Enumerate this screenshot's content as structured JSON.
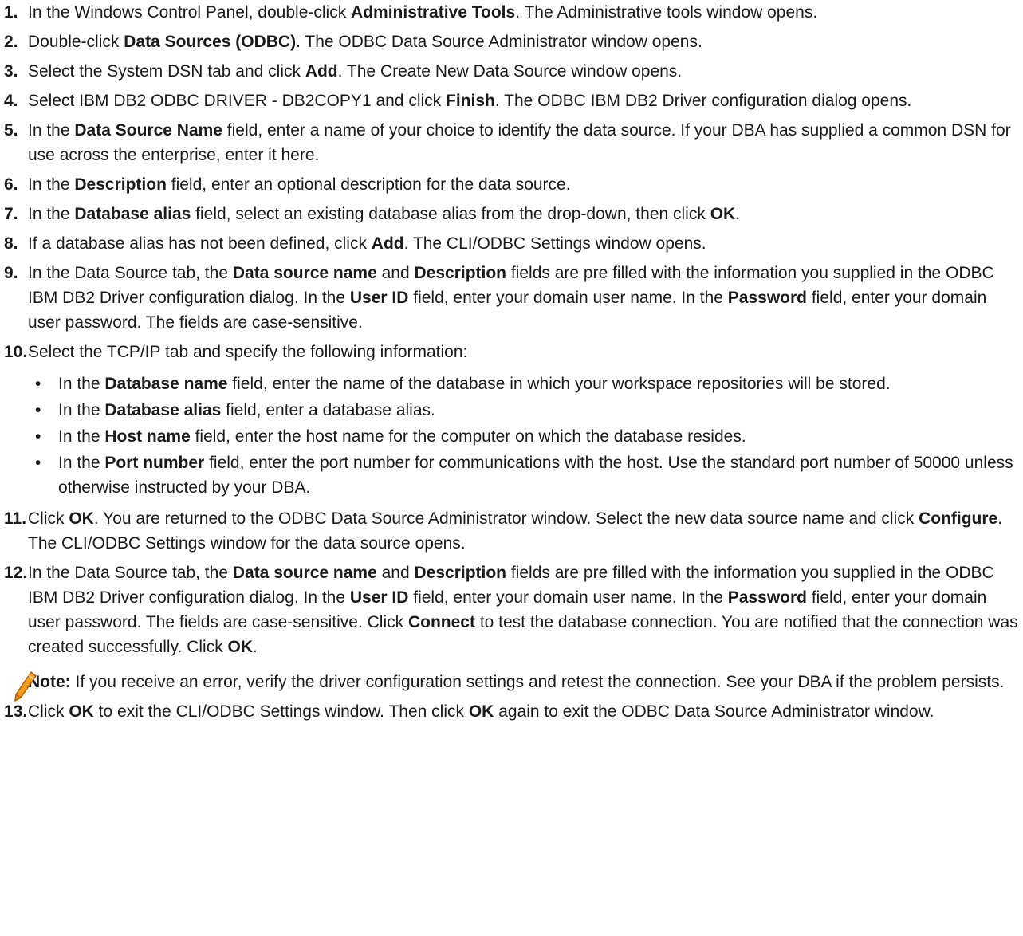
{
  "steps": [
    {
      "n": "1.",
      "parts": [
        [
          "t",
          "In the Windows Control Panel, double-click "
        ],
        [
          "b",
          "Administrative Tools"
        ],
        [
          "t",
          ". The Administrative tools window opens."
        ]
      ]
    },
    {
      "n": "2.",
      "parts": [
        [
          "t",
          "Double-click "
        ],
        [
          "b",
          "Data Sources (ODBC)"
        ],
        [
          "t",
          ". The ODBC Data Source Administrator window opens."
        ]
      ]
    },
    {
      "n": "3.",
      "parts": [
        [
          "t",
          "Select the System DSN tab and click "
        ],
        [
          "b",
          "Add"
        ],
        [
          "t",
          ". The Create New Data Source window opens."
        ]
      ]
    },
    {
      "n": "4.",
      "parts": [
        [
          "t",
          "Select IBM DB2 ODBC DRIVER - DB2COPY1 and click "
        ],
        [
          "b",
          "Finish"
        ],
        [
          "t",
          ". The ODBC IBM DB2 Driver configuration dialog opens."
        ]
      ]
    },
    {
      "n": "5.",
      "parts": [
        [
          "t",
          "In the "
        ],
        [
          "b",
          "Data Source Name"
        ],
        [
          "t",
          " field, enter a name of your choice to identify the data source. If your DBA has supplied a common DSN for use across the enterprise, enter it here."
        ]
      ]
    },
    {
      "n": "6.",
      "parts": [
        [
          "t",
          "In the "
        ],
        [
          "b",
          "Description"
        ],
        [
          "t",
          " field, enter an optional description for the data source."
        ]
      ]
    },
    {
      "n": "7.",
      "parts": [
        [
          "t",
          "In the "
        ],
        [
          "b",
          "Database alias"
        ],
        [
          "t",
          " field, select an existing database alias from the drop-down, then click "
        ],
        [
          "b",
          "OK"
        ],
        [
          "t",
          "."
        ]
      ]
    },
    {
      "n": "8.",
      "parts": [
        [
          "t",
          "If a database alias has not been defined, click "
        ],
        [
          "b",
          "Add"
        ],
        [
          "t",
          ". The CLI/ODBC Settings window opens."
        ]
      ]
    },
    {
      "n": "9.",
      "parts": [
        [
          "t",
          "In the Data Source tab, the "
        ],
        [
          "b",
          "Data source name"
        ],
        [
          "t",
          " and "
        ],
        [
          "b",
          "Description"
        ],
        [
          "t",
          " fields are pre filled with the information you supplied in the ODBC IBM DB2 Driver configuration dialog. In the "
        ],
        [
          "b",
          "User ID"
        ],
        [
          "t",
          " field, enter your domain user name. In the "
        ],
        [
          "b",
          "Password"
        ],
        [
          "t",
          " field, enter your domain user password. The fields are case-sensitive."
        ]
      ]
    },
    {
      "n": "10.",
      "parts": [
        [
          "t",
          "Select the TCP/IP tab and specify the following information:"
        ]
      ],
      "bullets": [
        [
          [
            "t",
            "In the "
          ],
          [
            "b",
            "Database name"
          ],
          [
            "t",
            " field, enter the name of the database in which your workspace repositories will be stored."
          ]
        ],
        [
          [
            "t",
            "In the "
          ],
          [
            "b",
            "Database alias"
          ],
          [
            "t",
            " field, enter a database alias."
          ]
        ],
        [
          [
            "t",
            "In the "
          ],
          [
            "b",
            "Host name"
          ],
          [
            "t",
            " field, enter the host name for the computer on which the database resides."
          ]
        ],
        [
          [
            "t",
            "In the "
          ],
          [
            "b",
            "Port number"
          ],
          [
            "t",
            " field, enter the port number for communications with the host. Use the standard port number of 50000 unless otherwise instructed by your DBA."
          ]
        ]
      ]
    },
    {
      "n": "11.",
      "parts": [
        [
          "t",
          "Click "
        ],
        [
          "b",
          "OK"
        ],
        [
          "t",
          ". You are returned to the ODBC Data Source Administrator window. Select the new data source name and click "
        ],
        [
          "b",
          "Configure"
        ],
        [
          "t",
          ". The CLI/ODBC Settings window for the data source opens."
        ]
      ]
    },
    {
      "n": "12.",
      "parts": [
        [
          "t",
          "In the Data Source tab, the "
        ],
        [
          "b",
          "Data source name"
        ],
        [
          "t",
          " and "
        ],
        [
          "b",
          "Description"
        ],
        [
          "t",
          " fields are pre filled with the information you supplied in the ODBC IBM DB2 Driver configuration dialog. In the "
        ],
        [
          "b",
          "User ID"
        ],
        [
          "t",
          " field, enter your domain user name. In the "
        ],
        [
          "b",
          "Password"
        ],
        [
          "t",
          " field, enter your domain user password. The fields are case-sensitive. Click "
        ],
        [
          "b",
          "Connect"
        ],
        [
          "t",
          " to test the database connection. You are notified that the connection was created successfully. Click "
        ],
        [
          "b",
          "OK"
        ],
        [
          "t",
          "."
        ]
      ],
      "note": [
        [
          "b",
          "Note:"
        ],
        [
          "t",
          " If you receive an error, verify the driver configuration settings and retest the connection. See your DBA if the problem persists."
        ]
      ]
    },
    {
      "n": "13.",
      "parts": [
        [
          "t",
          "Click "
        ],
        [
          "b",
          "OK"
        ],
        [
          "t",
          " to exit the CLI/ODBC Settings window. Then click "
        ],
        [
          "b",
          "OK"
        ],
        [
          "t",
          " again to exit the ODBC Data Source Administrator window."
        ]
      ]
    }
  ],
  "bullet_glyph": "•",
  "colors": {
    "text": "#1a1a1a",
    "pencil_body": "#f29a1e",
    "pencil_outline": "#b35f00"
  },
  "icons": {
    "note": "pencil-icon"
  }
}
